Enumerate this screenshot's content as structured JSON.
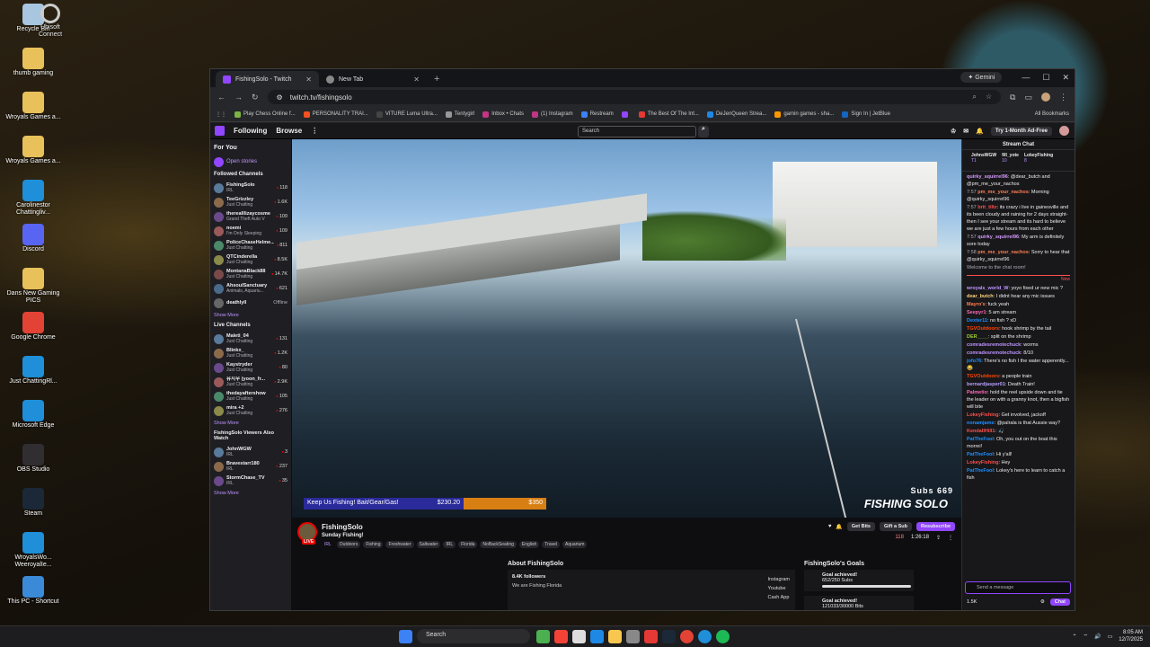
{
  "desktop": {
    "icons": [
      {
        "label": "Recycle Bin",
        "icon": "recycle-bin-icon",
        "color": "#a8c6e0"
      },
      {
        "label": "thumb gaming",
        "icon": "folder-icon",
        "color": "#e8c15a"
      },
      {
        "label": "Wroyals Games a...",
        "icon": "folder-icon",
        "color": "#e8c15a"
      },
      {
        "label": "Wroyals Games a...",
        "icon": "folder-icon",
        "color": "#e8c15a"
      },
      {
        "label": "Carolinestor Chattingliv...",
        "icon": "edge-icon",
        "color": "#1e8fd8"
      },
      {
        "label": "Discord",
        "icon": "discord-icon",
        "color": "#5865f2"
      },
      {
        "label": "Dans New Gaming PICS",
        "icon": "folder-icon",
        "color": "#e8c15a"
      },
      {
        "label": "Google Chrome",
        "icon": "chrome-icon",
        "color": "#e24335"
      },
      {
        "label": "Just ChattingRl...",
        "icon": "edge-icon",
        "color": "#1e8fd8"
      },
      {
        "label": "Microsoft Edge",
        "icon": "edge-icon",
        "color": "#1e8fd8"
      },
      {
        "label": "OBS Studio",
        "icon": "obs-icon",
        "color": "#302e31"
      },
      {
        "label": "Steam",
        "icon": "steam-icon",
        "color": "#1b2838"
      },
      {
        "label": "WroyalsWo... WeeroyalIe...",
        "icon": "edge-icon",
        "color": "#1e8fd8"
      },
      {
        "label": "This PC - Shortcut",
        "icon": "monitor-icon",
        "color": "#3a8ad8"
      }
    ],
    "ubisoft": "Ubisoft Connect"
  },
  "browser": {
    "tabs": [
      {
        "title": "FishingSolo - Twitch"
      },
      {
        "title": "New Tab"
      }
    ],
    "gemini": "Gemini",
    "url": "twitch.tv/fishingsolo",
    "bookmarks": [
      "Play Chess Online f...",
      "PERSONALITY TRAI...",
      "VITURE Luma Ultra...",
      "Tentygirl",
      "Inbox • Chats",
      "(1) Instagram",
      "Restream",
      "",
      "The Best Of The Int...",
      "DeJenQueen Strea...",
      "gamin games - sha...",
      "Sign In | JetBlue"
    ],
    "all_bookmarks": "All Bookmarks"
  },
  "twitch": {
    "nav": {
      "following": "Following",
      "browse": "Browse",
      "search_placeholder": "Search",
      "ad_free": "Try 1-Month Ad-Free"
    },
    "side": {
      "for_you": "For You",
      "open_stories": "Open stories",
      "followed_h": "Followed Channels",
      "followed": [
        {
          "n": "FishingSolo",
          "c": "IRL",
          "v": "118"
        },
        {
          "n": "TeeGrizzley",
          "c": "Just Chatting",
          "v": "1.6K"
        },
        {
          "n": "therealllizaycosme",
          "c": "Grand Theft Auto V",
          "v": "109"
        },
        {
          "n": "noemi",
          "c": "I'm Only Sleeping",
          "v": "109"
        },
        {
          "n": "PoliceChaseHelme...",
          "c": "Just Chatting",
          "v": "811"
        },
        {
          "n": "QTCinderella",
          "c": "Just Chatting",
          "v": "8.5K"
        },
        {
          "n": "MontanaBlack88",
          "c": "Just Chatting",
          "v": "14.7K"
        },
        {
          "n": "AhsoulSanctuary",
          "c": "Animals, Aquariu...",
          "v": "621"
        },
        {
          "n": "deathlyll",
          "c": "",
          "v": "Offline"
        }
      ],
      "show_more": "Show More",
      "live_h": "Live Channels",
      "live": [
        {
          "n": "Maleti_04",
          "c": "Just Chatting",
          "v": "131"
        },
        {
          "n": "Blinkx_",
          "c": "Just Chatting",
          "v": "1.2K"
        },
        {
          "n": "Kaystryder",
          "c": "Just Chatting",
          "v": "80"
        },
        {
          "n": "유지우 (yoon_fr...",
          "c": "Just Chatting",
          "v": "2.9K"
        },
        {
          "n": "thedayaftershow",
          "c": "Just Chatting",
          "v": "105"
        },
        {
          "n": "mira +2",
          "c": "Just Chatting",
          "v": "276"
        }
      ],
      "also_h": "FishingSolo Viewers Also Watch",
      "also": [
        {
          "n": "JohnWGW",
          "c": "IRL",
          "v": "3"
        },
        {
          "n": "Bravestarr180",
          "c": "IRL",
          "v": "237"
        },
        {
          "n": "StormChase_TV",
          "c": "IRL",
          "v": "35"
        }
      ]
    },
    "video": {
      "goal_text": "Keep Us Fishing! Bait/Gear/Gas!",
      "goal_raised": "$230.20",
      "goal_target": "$350",
      "subs": "Subs 669",
      "watermark": "FISHING SOLO"
    },
    "info": {
      "channel": "FishingSolo",
      "live": "LIVE",
      "title": "Sunday Fishing!",
      "category": "IRL",
      "tags": [
        "Outdoors",
        "Fishing",
        "Freshwater",
        "Saltwater",
        "IRL",
        "Florida",
        "NoBackSeating",
        "English",
        "Travel",
        "Aquarium"
      ],
      "get_bits": "Get Bits",
      "gift_sub": "Gift a Sub",
      "resubscribe": "Resubscribe",
      "viewers": "118",
      "uptime": "1:26:18",
      "about_h": "About FishingSolo",
      "followers": "8.4K followers",
      "bio": "We are Fishing Florida",
      "links": [
        "Instagram",
        "Youtube",
        "Cash App"
      ],
      "goals_h": "FishingSolo's Goals",
      "goals": [
        {
          "t": "Goal achieved!",
          "d": "652/250 Subs",
          "progress": 1
        },
        {
          "t": "Goal achieved!",
          "d": "121033/30000 Bits",
          "progress": 1
        }
      ]
    },
    "chat": {
      "header": "Stream Chat",
      "pins": [
        {
          "user": "JohnsWGW",
          "sub": "T1"
        },
        {
          "user": "fill_yote",
          "sub": "10"
        },
        {
          "user": "LokeyFishing",
          "sub": "8"
        }
      ],
      "messages": [
        {
          "t": "",
          "u": "quirky_squirrel96",
          "c": "#d89aff",
          "m": "@dear_butch and @pm_me_your_nachos"
        },
        {
          "t": "7:57",
          "u": "pm_me_your_nachos",
          "c": "#ff7f50",
          "m": "Morning @quirky_squirrel96"
        },
        {
          "t": "7:57",
          "u": "brit_tiltz",
          "c": "#ff4f4d",
          "m": "its crazy i live in gainesville and its been cloudy and raining for 2 days straight- then I see your stream and its hard to believe we are just a few hours from each other"
        },
        {
          "t": "7:57",
          "u": "quirky_squirrel96",
          "c": "#d89aff",
          "m": "My arm is definitely sore today"
        },
        {
          "t": "7:58",
          "u": "pm_me_your_nachos",
          "c": "#ff7f50",
          "m": "Sorry to hear that @quirky_squirrel96"
        },
        {
          "t": "",
          "u": "",
          "c": "#adadb8",
          "m": "Welcome to the chat room!"
        }
      ],
      "new_label": "New",
      "messages2": [
        {
          "u": "wroyals_world_W",
          "c": "#bf94ff",
          "m": "yoyo fixed ur new mic ?"
        },
        {
          "u": "dear_butch",
          "c": "#ffd37a",
          "m": "I didnt hear any mic issues"
        },
        {
          "u": "Mayro's",
          "c": "#ff7f50",
          "m": "fuck yeah"
        },
        {
          "u": "Seepyr1",
          "c": "#ff69b4",
          "m": "5 am stream"
        },
        {
          "u": "Dexter11",
          "c": "#1e90ff",
          "m": "no fish ? xD"
        },
        {
          "u": "TGVOutdoors",
          "c": "#ff4500",
          "m": "hook shrimp by the tail"
        },
        {
          "u": "DER____",
          "c": "#9acd32",
          "m": "split on the shrimp"
        },
        {
          "u": "comradesremotechuck",
          "c": "#bf94ff",
          "m": "worms"
        },
        {
          "u": "comradesremotechuck",
          "c": "#bf94ff",
          "m": "8/10"
        },
        {
          "u": "jofo76",
          "c": "#1e90ff",
          "m": "There's no fish I the water apperently...😂"
        },
        {
          "u": "TGVOutdoors",
          "c": "#ff4500",
          "m": "a people train"
        },
        {
          "u": "bernardjasper01",
          "c": "#b8a0ff",
          "m": "Death Train!"
        },
        {
          "u": "Palmetio",
          "c": "#ff69b4",
          "m": "hold the reel upside down and tie the leader on with a granny knot, then a bigfish will bite"
        },
        {
          "u": "LokeyFishing",
          "c": "#ff4f4d",
          "m": "Get involved, jackoff"
        },
        {
          "u": "nonamjame",
          "c": "#1e90ff",
          "m": "@palrala is that Aussie way?"
        },
        {
          "u": "KendallHill1",
          "c": "#ff4f4d",
          "m": "🎣"
        },
        {
          "u": "PatTheFool",
          "c": "#1e90ff",
          "m": "Oh, you out on the boat this morrei!"
        },
        {
          "u": "PatTheFool",
          "c": "#1e90ff",
          "m": "Hi y'all!"
        },
        {
          "u": "LokeyFishing",
          "c": "#ff4f4d",
          "m": "Hey"
        },
        {
          "u": "PatTheFool",
          "c": "#1e90ff",
          "m": "Lokey's here to learn to catch a fish"
        }
      ],
      "input_placeholder": "Send a message",
      "points": "1.5K",
      "send": "Chat"
    }
  },
  "taskbar": {
    "search": "Search",
    "time": "8:05 AM",
    "date": "12/7/2025"
  }
}
